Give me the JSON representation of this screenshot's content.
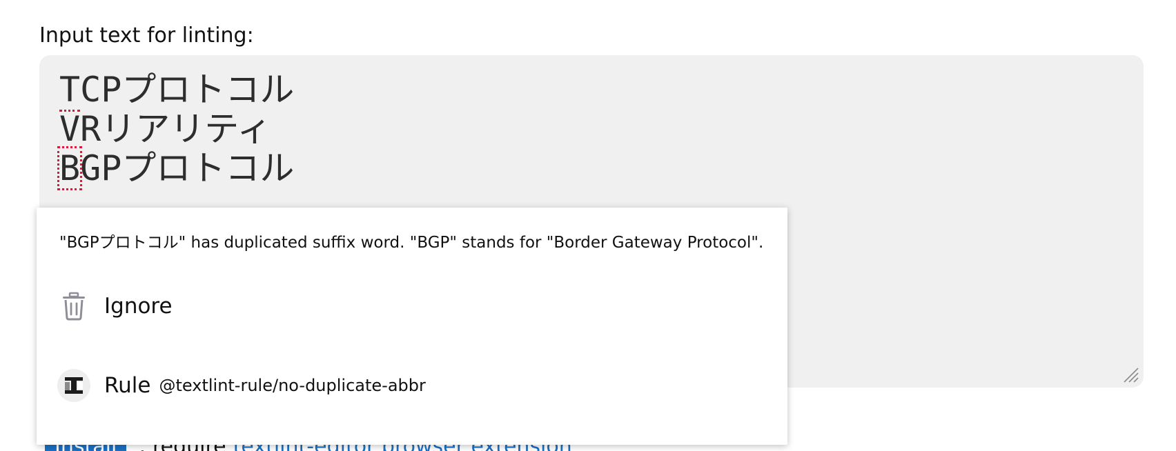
{
  "input_label": "Input text for linting:",
  "editor": {
    "lines": [
      {
        "first": "T",
        "rest": "CPプロトコル"
      },
      {
        "text": "VRリアリティ"
      },
      {
        "first": "B",
        "rest": "GPプロトコル"
      }
    ]
  },
  "below": {
    "install_label": "Install",
    "require_text": ": require",
    "link_text": "textlint-editor browser extension"
  },
  "popup": {
    "message": "\"BGPプロトコル\" has duplicated suffix word. \"BGP\" stands for \"Border Gateway Protocol\".",
    "ignore_label": "Ignore",
    "ignore_icon": "trash-icon",
    "rule_label": "Rule",
    "rule_name": "@textlint-rule/no-duplicate-abbr",
    "rule_icon": "textlint-logo-icon"
  },
  "colors": {
    "editor_bg": "#f0f0f0",
    "error_mark": "#d6193c",
    "link": "#1a6fc4",
    "icon_gray": "#8e8e98"
  }
}
